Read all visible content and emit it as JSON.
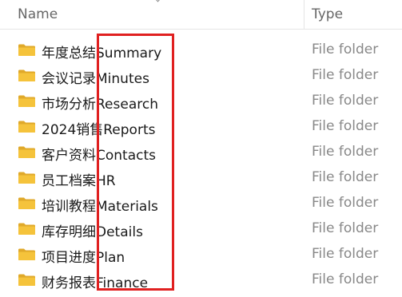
{
  "header": {
    "name_label": "Name",
    "type_label": "Type"
  },
  "rows": [
    {
      "name": "年度总结Summary",
      "type": "File folder",
      "icon": "folder-icon"
    },
    {
      "name": "会议记录Minutes",
      "type": "File folder",
      "icon": "folder-icon"
    },
    {
      "name": "市场分析Research",
      "type": "File folder",
      "icon": "folder-icon"
    },
    {
      "name": "2024销售Reports",
      "type": "File folder",
      "icon": "folder-icon"
    },
    {
      "name": "客户资料Contacts",
      "type": "File folder",
      "icon": "folder-icon"
    },
    {
      "name": "员工档案HR",
      "type": "File folder",
      "icon": "folder-icon"
    },
    {
      "name": "培训教程Materials",
      "type": "File folder",
      "icon": "folder-icon"
    },
    {
      "name": "库存明细Details",
      "type": "File folder",
      "icon": "folder-icon"
    },
    {
      "name": "项目进度Plan",
      "type": "File folder",
      "icon": "folder-icon"
    },
    {
      "name": "财务报表Finance",
      "type": "File folder",
      "icon": "folder-icon"
    }
  ],
  "colors": {
    "highlight": "#e02020",
    "folder_body": "#f5c33b",
    "folder_tab": "#e0a92a"
  }
}
